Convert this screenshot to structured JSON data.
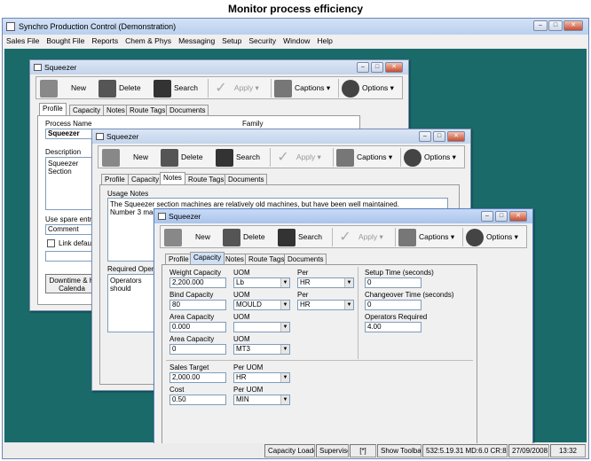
{
  "caption": "Monitor process efficiency",
  "app": {
    "title": "Synchro Production Control (Demonstration)"
  },
  "menu": [
    "Sales File",
    "Bought File",
    "Reports",
    "Chem & Phys",
    "Messaging",
    "Setup",
    "Security",
    "Window",
    "Help"
  ],
  "toolbar": {
    "new": "New",
    "delete": "Delete",
    "search": "Search",
    "apply": "Apply",
    "captions": "Captions",
    "options": "Options"
  },
  "window_title": "Squeezer",
  "tabs": {
    "profile": "Profile",
    "capacity": "Capacity",
    "notes": "Notes",
    "route_tags": "Route Tags",
    "documents": "Documents"
  },
  "win1": {
    "process_name_label": "Process Name",
    "process_name": "Squeezer",
    "family_label": "Family",
    "description_label": "Description",
    "description": "Squeezer Section",
    "spare_label": "Use spare entry f",
    "spare_value": "Comment",
    "link_label": "Link default s",
    "downtime_label": "Downtime & H",
    "calendar_label": "Calenda"
  },
  "win2": {
    "usage_notes_label": "Usage Notes",
    "usage_notes_1": "The Squeezer section machines are relatively old machines, but have been well maintained.",
    "usage_notes_2": "Number 3 machi",
    "required_label": "Required Operato",
    "required_value": "Operators should"
  },
  "capacity": {
    "weight_label": "Weight Capacity",
    "weight": "2,200.000",
    "weight_uom": "Lb",
    "weight_per": "HR",
    "bind_label": "Bind Capacity",
    "bind": "80",
    "bind_uom": "MOULD",
    "bind_per": "HR",
    "area_label": "Area Capacity",
    "area": "0.000",
    "area_uom": "",
    "area2_label": "Area Capacity",
    "area2": "0",
    "area2_uom": "MT3",
    "uom_label": "UOM",
    "per_label": "Per",
    "setup_label": "Setup Time (seconds)",
    "setup": "0",
    "changeover_label": "Changeover Time (seconds)",
    "changeover": "0",
    "operators_label": "Operators Required",
    "operators": "4.00",
    "sales_label": "Sales Target",
    "sales": "2,000.00",
    "per_uom_label": "Per UOM",
    "sales_per": "HR",
    "cost_label": "Cost",
    "cost": "0.50",
    "cost_per": "MIN"
  },
  "status": {
    "capacity": "Capacity Loaded",
    "user": "Supervisor",
    "flag": "[*]",
    "toolbar": "Show Toolbar",
    "coords": "532:5.19.31 MD:6.0 CR:8/8.5",
    "date": "27/09/2008",
    "time": "13:32"
  }
}
